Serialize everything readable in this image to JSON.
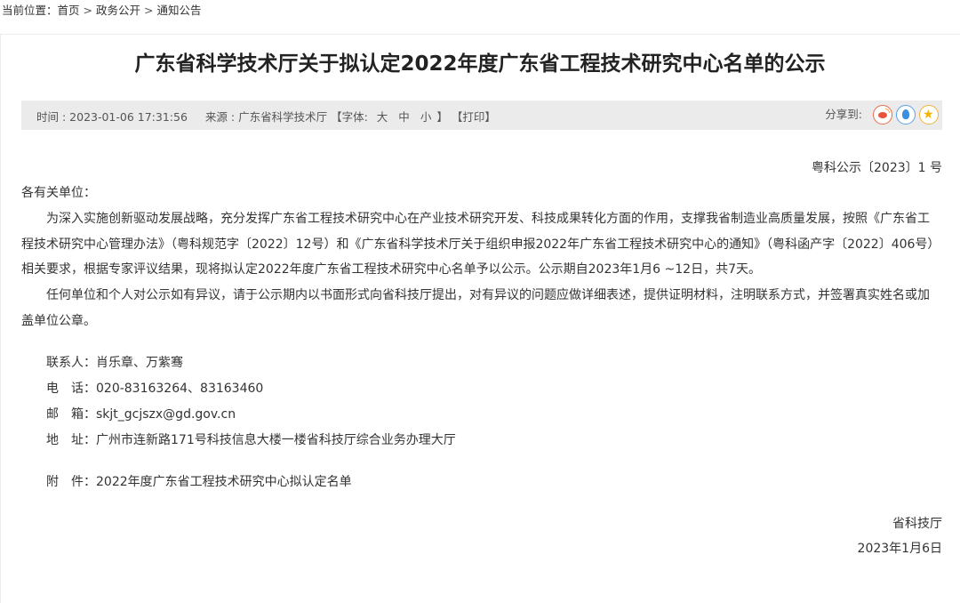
{
  "breadcrumb": {
    "prefix": "当前位置：",
    "items": [
      "首页",
      "政务公开",
      "通知公告"
    ],
    "separator": ">"
  },
  "article": {
    "title": "广东省科学技术厅关于拟认定2022年度广东省工程技术研究中心名单的公示",
    "meta": {
      "time": "时间 : 2023-01-06 17:31:56",
      "source": "来源 : 广东省科学技术厅",
      "font_open": "【字体:",
      "font_large": "大",
      "font_medium": "中",
      "font_small": "小",
      "font_close": "】",
      "print": "【打印】",
      "share_label": "分享到:"
    },
    "doc_number": "粤科公示〔2023〕1 号",
    "salutation": "各有关单位：",
    "paragraph1": "为深入实施创新驱动发展战略，充分发挥广东省工程技术研究中心在产业技术研究开发、科技成果转化方面的作用，支撑我省制造业高质量发展，按照《广东省工程技术研究中心管理办法》（粤科规范字〔2022〕12号）和《广东省科学技术厅关于组织申报2022年广东省工程技术研究中心的通知》（粤科函产字〔2022〕406号）相关要求，根据专家评议结果，现将拟认定2022年度广东省工程技术研究中心名单予以公示。公示期自2023年1月6 ~12日，共7天。",
    "paragraph2": "任何单位和个人对公示如有异议，请于公示期内以书面形式向省科技厅提出，对有异议的问题应做详细表述，提供证明材料，注明联系方式，并签署真实姓名或加盖单位公章。",
    "contact": {
      "person_label": "联系人：",
      "person": "肖乐章、万紫骞",
      "phone_label": "电　话：",
      "phone": "020-83163264、83163460",
      "email_label": "邮　箱：",
      "email": "skjt_gcjszx@gd.gov.cn",
      "address_label": "地　址：",
      "address": "广州市连新路171号科技信息大楼一楼省科技厅综合业务办理大厅"
    },
    "attachment_label": "附　件：",
    "attachment": "2022年度广东省工程技术研究中心拟认定名单",
    "signature": "省科技厅",
    "date": "2023年1月6日"
  },
  "icons": {
    "share": [
      "weibo-icon",
      "qq-icon",
      "qzone-icon"
    ]
  }
}
